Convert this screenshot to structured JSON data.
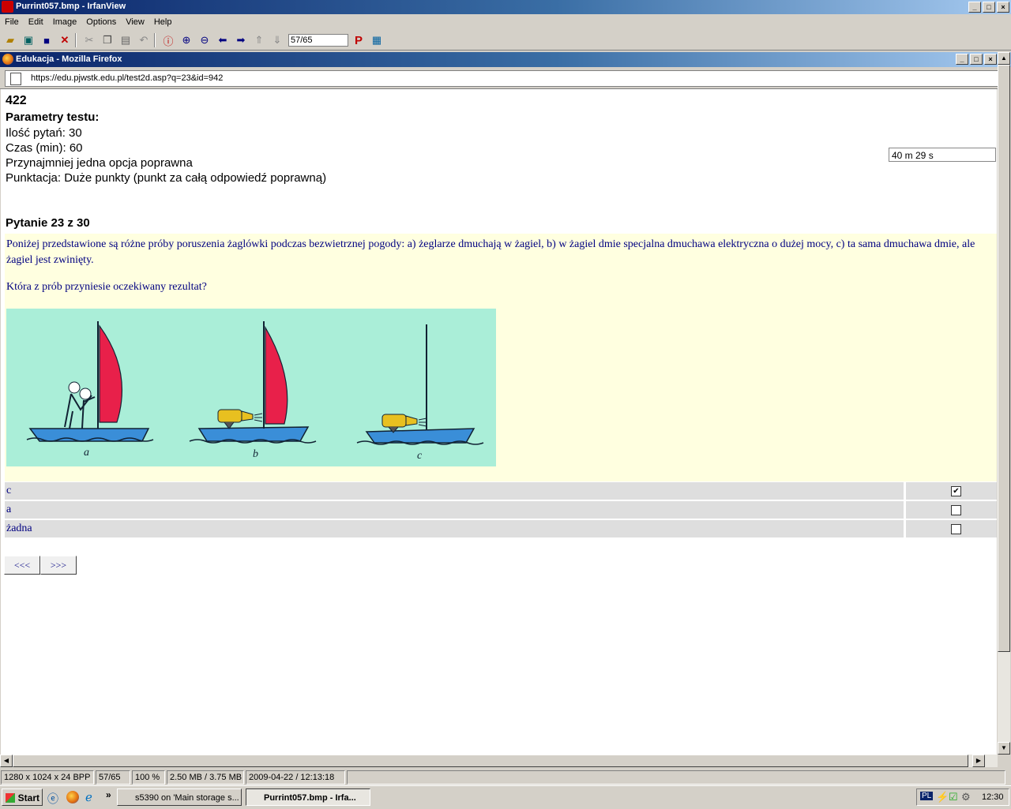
{
  "irfan": {
    "title": "Purrint057.bmp - IrfanView",
    "menu": [
      "File",
      "Edit",
      "Image",
      "Options",
      "View",
      "Help"
    ],
    "page_counter": "57/65"
  },
  "firefox": {
    "title": "Edukacja - Mozilla Firefox",
    "url": "https://edu.pjwstk.edu.pl/test2d.asp?q=23&id=942"
  },
  "test": {
    "id": "422",
    "params_heading": "Parametry testu:",
    "params": [
      "Ilość pytań: 30",
      "Czas (min): 60",
      "Przynajmniej jedna opcja poprawna",
      "Punktacja: Duże punkty (punkt za całą odpowiedź poprawną)"
    ],
    "timer": "40 m  29 s"
  },
  "question": {
    "heading": "Pytanie 23 z 30",
    "text": "Poniżej przedstawione są różne próby poruszenia żaglówki podczas bezwietrznej pogody: a) żeglarze dmuchają w żagiel, b) w żagiel dmie specjalna dmuchawa elektryczna o dużej mocy, c) ta sama dmuchawa dmie, ale żagiel jest zwinięty.",
    "ask": "Która z prób przyniesie oczekiwany rezultat?",
    "image_labels": [
      "a",
      "b",
      "c"
    ],
    "answers": [
      {
        "label": "c",
        "checked": true
      },
      {
        "label": "a",
        "checked": false
      },
      {
        "label": "żadna",
        "checked": false
      }
    ],
    "prev": "<<<",
    "next": ">>>"
  },
  "colors": {
    "sail": "#e8204a",
    "hull": "#3a8ed8",
    "water_bg": "#aaeed8",
    "blower": "#e8c020"
  },
  "status": {
    "cells": [
      "1280 x 1024 x 24 BPP",
      "57/65",
      "100 %",
      "2.50 MB / 3.75 MB",
      "2009-04-22 / 12:13:18"
    ]
  },
  "taskbar": {
    "start": "Start",
    "tasks": [
      "s5390 on 'Main storage s...",
      "Purrint057.bmp - Irfa..."
    ],
    "lang": "PL",
    "clock": "12:30"
  }
}
